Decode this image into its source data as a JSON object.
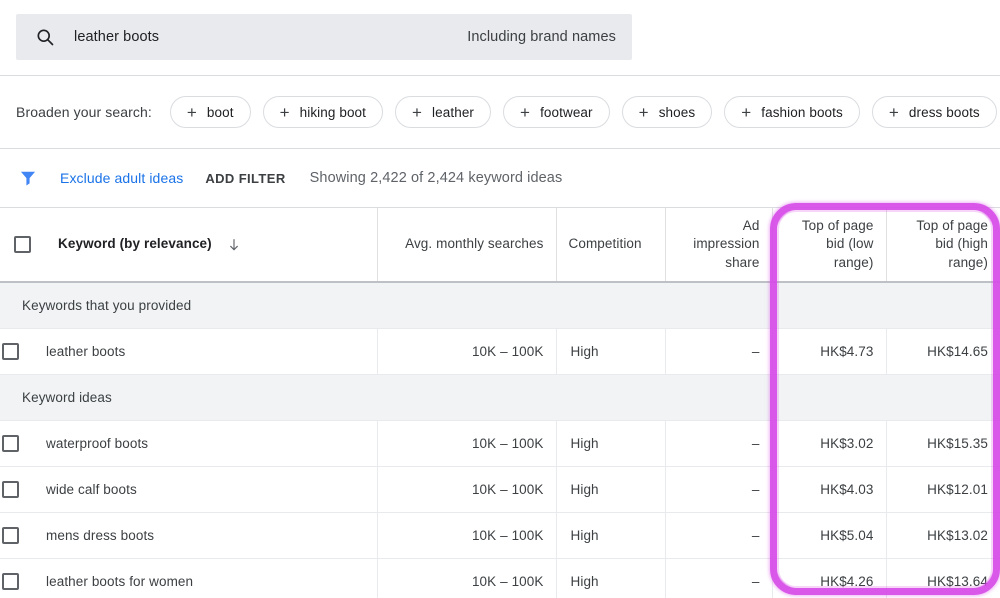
{
  "search": {
    "icon": "search-icon",
    "value": "leather boots",
    "suffix": "Including brand names"
  },
  "broaden": {
    "label": "Broaden your search:",
    "chips": [
      {
        "label": "boot"
      },
      {
        "label": "hiking boot"
      },
      {
        "label": "leather"
      },
      {
        "label": "footwear"
      },
      {
        "label": "shoes"
      },
      {
        "label": "fashion boots"
      },
      {
        "label": "dress boots"
      }
    ]
  },
  "filters": {
    "icon": "filter-funnel-icon",
    "exclude_adult_label": "Exclude adult ideas",
    "add_filter_label": "ADD FILTER",
    "showing_text": "Showing 2,422 of 2,424 keyword ideas"
  },
  "table": {
    "headers": {
      "keyword": "Keyword (by relevance)",
      "sort_icon": "arrow-down-icon",
      "avg_monthly_searches": "Avg. monthly searches",
      "competition": "Competition",
      "ad_impression_share": "Ad impression share",
      "top_of_page_bid_low": "Top of page bid (low range)",
      "top_of_page_bid_high": "Top of page bid (high range)"
    },
    "sections": [
      {
        "title": "Keywords that you provided",
        "rows": [
          {
            "keyword": "leather boots",
            "avg_monthly_searches": "10K – 100K",
            "competition": "High",
            "ad_impression_share": "–",
            "bid_low": "HK$4.73",
            "bid_high": "HK$14.65"
          }
        ]
      },
      {
        "title": "Keyword ideas",
        "rows": [
          {
            "keyword": "waterproof boots",
            "avg_monthly_searches": "10K – 100K",
            "competition": "High",
            "ad_impression_share": "–",
            "bid_low": "HK$3.02",
            "bid_high": "HK$15.35"
          },
          {
            "keyword": "wide calf boots",
            "avg_monthly_searches": "10K – 100K",
            "competition": "High",
            "ad_impression_share": "–",
            "bid_low": "HK$4.03",
            "bid_high": "HK$12.01"
          },
          {
            "keyword": "mens dress boots",
            "avg_monthly_searches": "10K – 100K",
            "competition": "High",
            "ad_impression_share": "–",
            "bid_low": "HK$5.04",
            "bid_high": "HK$13.02"
          },
          {
            "keyword": "leather boots for women",
            "avg_monthly_searches": "10K – 100K",
            "competition": "High",
            "ad_impression_share": "–",
            "bid_low": "HK$4.26",
            "bid_high": "HK$13.64"
          }
        ]
      }
    ]
  },
  "annotation": {
    "name": "highlight-box-top-of-page-bid",
    "color": "#d64ae8"
  },
  "colors": {
    "link": "#1a73e8",
    "search_bar_bg": "#e8eaed",
    "section_row_bg": "#f1f3f4",
    "text_primary": "#202124",
    "text_secondary": "#3c4043",
    "text_muted": "#5f6368"
  }
}
